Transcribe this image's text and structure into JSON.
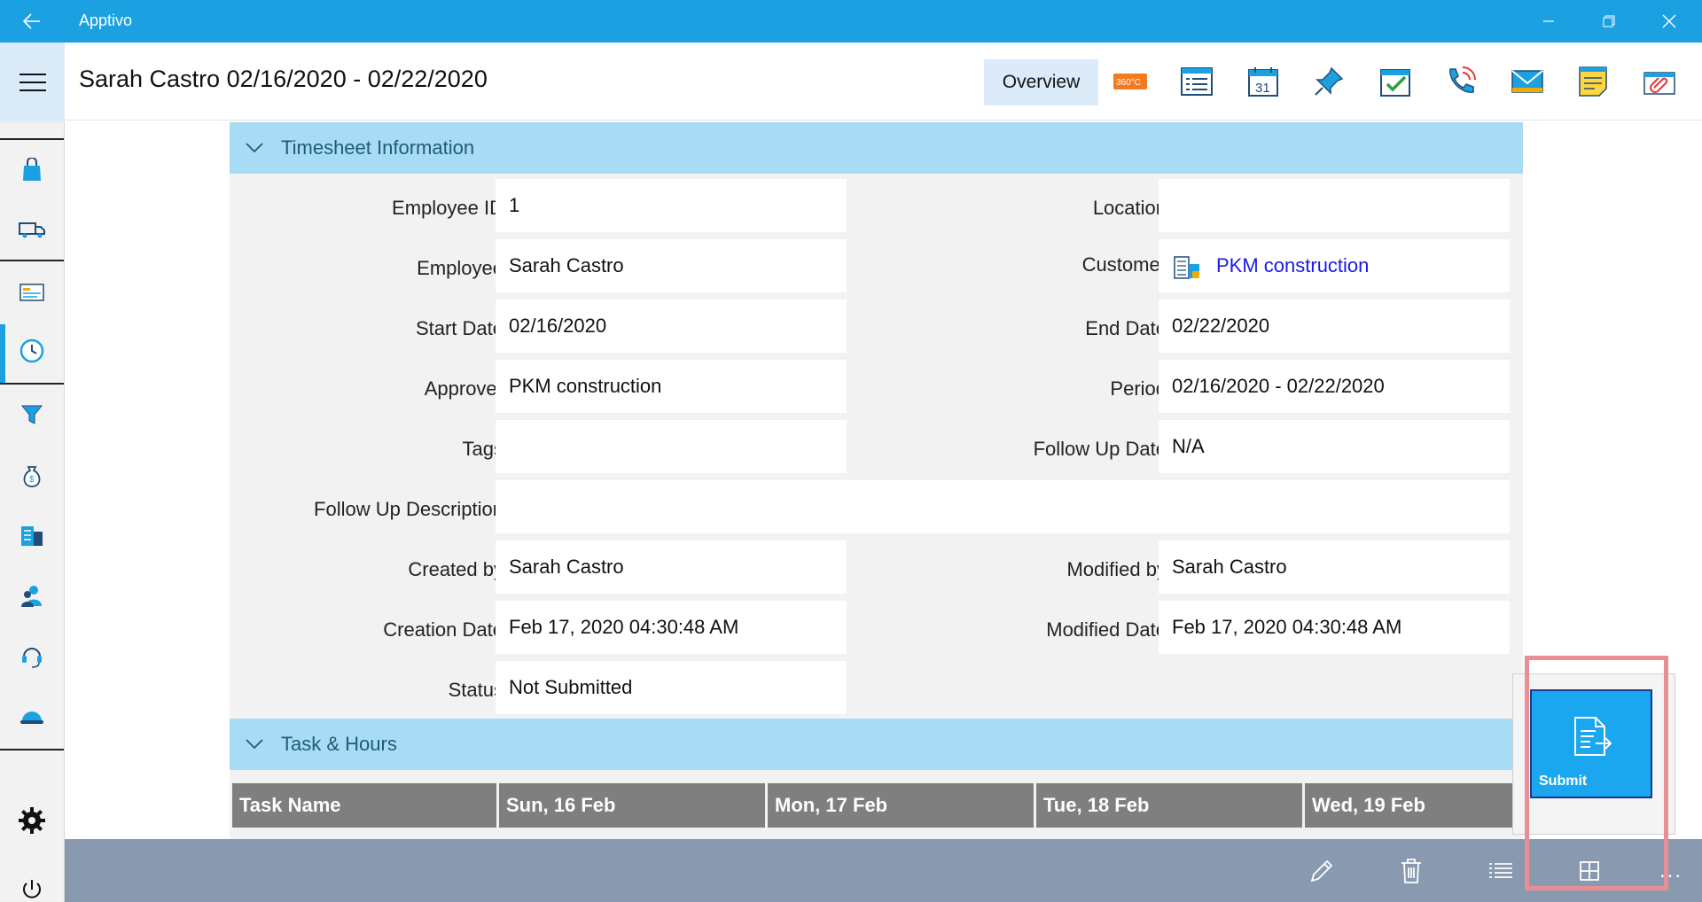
{
  "titlebar": {
    "app_title": "Apptivo"
  },
  "header": {
    "title": "Sarah Castro 02/16/2020 - 02/22/2020",
    "tab_overview": "Overview",
    "icon_360_text": "360°C",
    "calendar_day": "31"
  },
  "sections": {
    "timesheet_info": "Timesheet Information",
    "task_hours": "Task & Hours"
  },
  "fields": {
    "employee_id": {
      "label": "Employee ID",
      "value": "1"
    },
    "location": {
      "label": "Location",
      "value": ""
    },
    "employee": {
      "label": "Employee",
      "value": "Sarah Castro"
    },
    "customer": {
      "label": "Customer",
      "value": "PKM construction"
    },
    "start_date": {
      "label": "Start Date",
      "value": "02/16/2020"
    },
    "end_date": {
      "label": "End Date",
      "value": "02/22/2020"
    },
    "approver": {
      "label": "Approver",
      "value": "PKM construction"
    },
    "period": {
      "label": "Period",
      "value": "02/16/2020 - 02/22/2020"
    },
    "tags": {
      "label": "Tags",
      "value": ""
    },
    "follow_up_date": {
      "label": "Follow Up Date",
      "value": "N/A"
    },
    "follow_up_description": {
      "label": "Follow Up Description",
      "value": ""
    },
    "created_by": {
      "label": "Created by",
      "value": "Sarah Castro"
    },
    "modified_by": {
      "label": "Modified by",
      "value": "Sarah Castro"
    },
    "creation_date": {
      "label": "Creation Date",
      "value": "Feb 17, 2020 04:30:48 AM"
    },
    "modified_date": {
      "label": "Modified Date",
      "value": "Feb 17, 2020 04:30:48 AM"
    },
    "status": {
      "label": "Status",
      "value": "Not Submitted"
    }
  },
  "task_grid": {
    "columns": [
      "Task Name",
      "Sun, 16 Feb",
      "Mon, 17 Feb",
      "Tue, 18 Feb",
      "Wed, 19 Feb"
    ]
  },
  "popup": {
    "submit_label": "Submit"
  },
  "bottombar": {
    "more_label": "..."
  },
  "colors": {
    "accent": "#1ba1e2",
    "section_header": "#a8dcf4",
    "grid_header": "#7f7f7f",
    "bottom_bar": "#8999b0",
    "highlight": "#e88e95",
    "link": "#1a1ae8"
  }
}
